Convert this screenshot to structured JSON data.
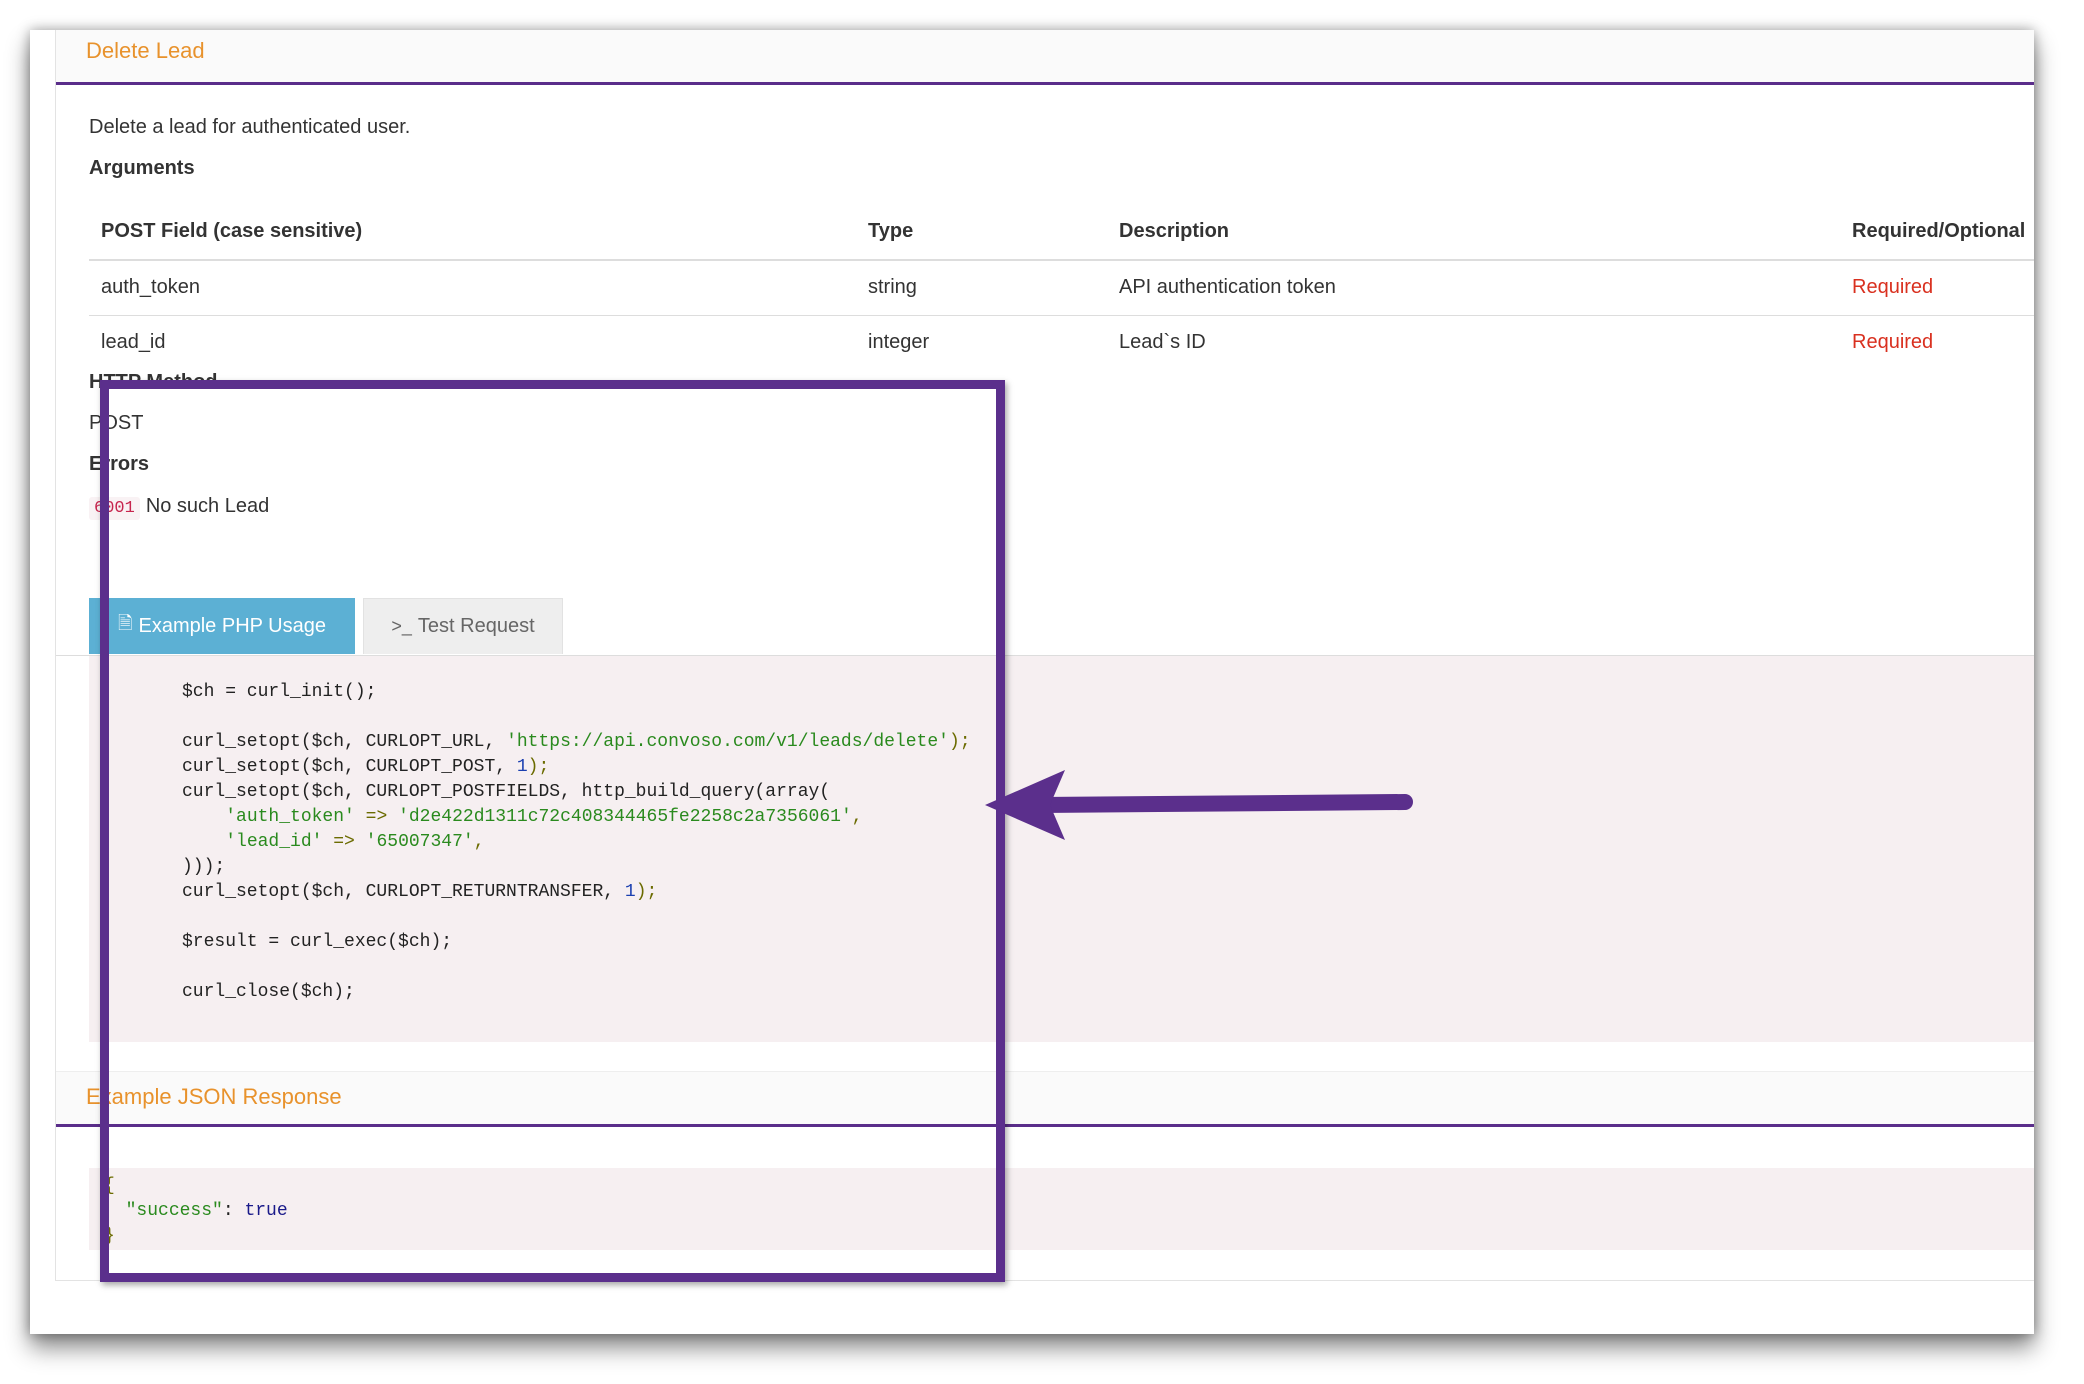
{
  "delete_lead": {
    "title": "Delete Lead",
    "description": "Delete a lead for authenticated user.",
    "arguments_label": "Arguments",
    "table": {
      "headers": [
        "POST Field (case sensitive)",
        "Type",
        "Description",
        "Required/Optional"
      ],
      "rows": [
        [
          "auth_token",
          "string",
          "API authentication token",
          "Required"
        ],
        [
          "lead_id",
          "integer",
          "Lead`s ID",
          "Required"
        ]
      ]
    },
    "http_method_label": "HTTP Method",
    "http_method": "POST",
    "errors_label": "Errors",
    "errors": [
      {
        "code": "6001",
        "message": "No such Lead"
      }
    ]
  },
  "tabs": {
    "example_php": "Example PHP Usage",
    "test_request": "Test Request"
  },
  "php_code": {
    "line1": "$ch = curl_init();",
    "line2_pre": "curl_setopt($ch, CURLOPT_URL, ",
    "line2_url": "'https://api.convoso.com/v1/leads/delete'",
    "line3_pre": "curl_setopt($ch, CURLOPT_POST, ",
    "line3_num": "1",
    "line4": "curl_setopt($ch, CURLOPT_POSTFIELDS, http_build_query(array(",
    "line5_key": "'auth_token'",
    "line5_val": "'d2e422d1311c72c408344465fe2258c2a7356061'",
    "line6_key": "'lead_id'",
    "line6_val": "'65007347'",
    "line7": ")));",
    "line8_pre": "curl_setopt($ch, CURLOPT_RETURNTRANSFER, ",
    "line8_num": "1",
    "line9": "$result = curl_exec($ch);",
    "line10": "curl_close($ch);"
  },
  "json_response": {
    "title": "Example JSON Response",
    "open": "{",
    "key": "\"success\"",
    "value": "true",
    "close": "}"
  },
  "annotation": {
    "box_color": "#5b2f8c",
    "arrow_color": "#5b2f8c"
  },
  "colors": {
    "section_title": "#e8922c",
    "section_rule": "#5a2d8a",
    "active_tab": "#5cb0d4",
    "required": "#d9301f",
    "code_bg": "#f6eff1"
  }
}
